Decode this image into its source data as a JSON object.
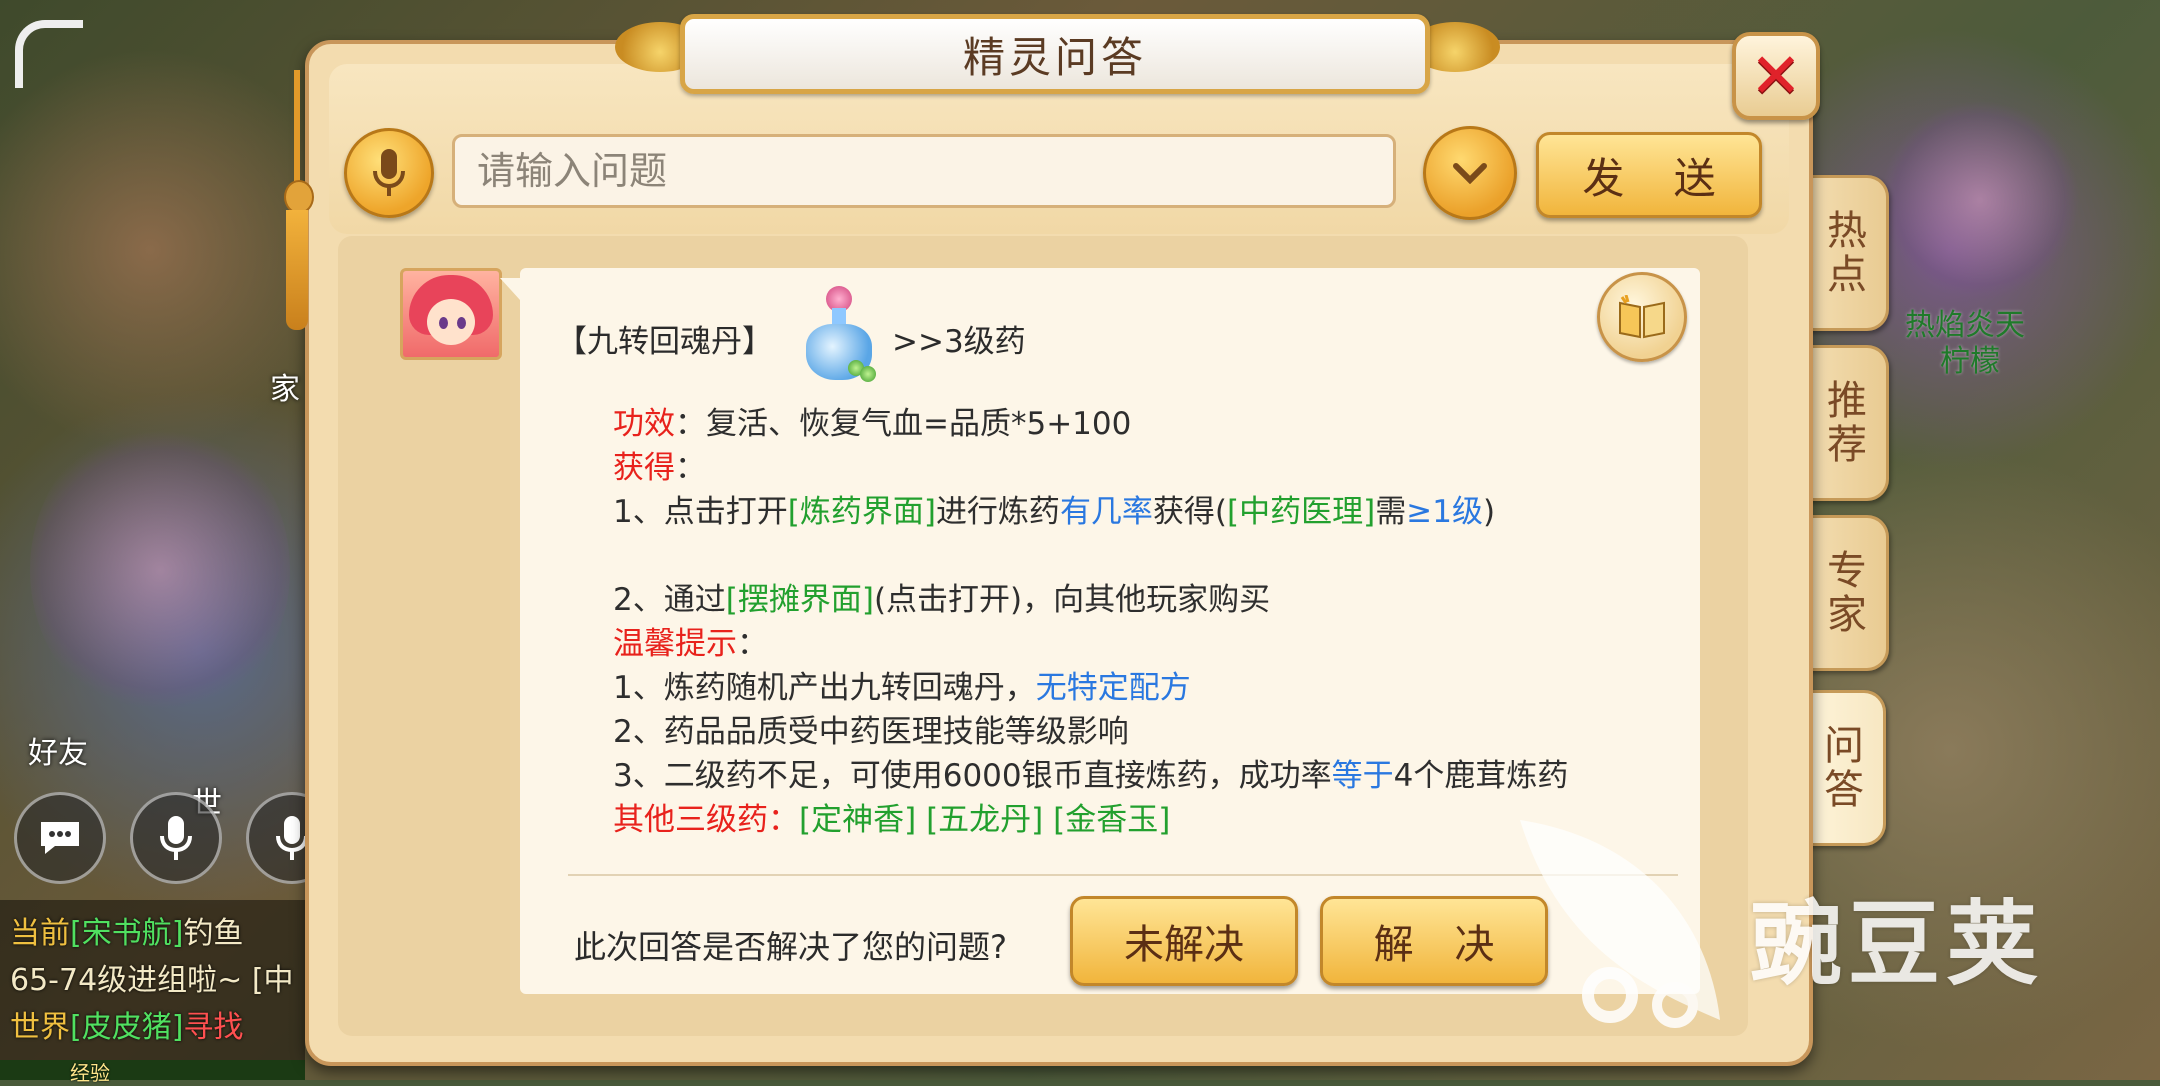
{
  "dialog": {
    "title": "精灵问答",
    "close_symbol": "✕"
  },
  "query": {
    "placeholder": "请输入问题",
    "send_label": "发 送"
  },
  "side_tabs": [
    {
      "label": "热点",
      "active": false
    },
    {
      "label": "推荐",
      "active": false
    },
    {
      "label": "专家",
      "active": false
    },
    {
      "label": "问答",
      "active": true
    }
  ],
  "answer": {
    "item_name": "【九转回魂丹】",
    "item_level": ">>3级药",
    "effect_label": "功效",
    "effect_text": "：复活、恢复气血=品质*5+100",
    "obtain_label": "获得",
    "obtain_colon": "：",
    "obtain_1": {
      "prefix": "1、点击打开",
      "link1": "[炼药界面]",
      "mid": "进行炼药",
      "chance": "有几率",
      "mid2": "获得(",
      "link2": "[中药医理]",
      "need": "需",
      "req": "≥1级",
      "end": ")"
    },
    "obtain_2": {
      "prefix": "2、通过",
      "link": "[摆摊界面]",
      "suffix": "(点击打开)，向其他玩家购买"
    },
    "tips_label": "温馨提示",
    "tips_colon": "：",
    "tip_1": {
      "text": "1、炼药随机产出九转回魂丹，",
      "highlight": "无特定配方"
    },
    "tip_2": {
      "text": "2、药品品质受中药医理技能等级影响"
    },
    "tip_3": {
      "text": "3、二级药不足，可使用6000银币直接炼药，成功率",
      "highlight": "等于",
      "tail": "4个鹿茸炼药"
    },
    "others_label": "其他三级药：",
    "others": [
      "[定神香]",
      "[五龙丹]",
      "[金香玉]"
    ]
  },
  "feedback": {
    "question": "此次回答是否解决了您的问题?",
    "unsolved": "未解决",
    "solved": "解 决"
  },
  "background": {
    "chat_lines": [
      {
        "tag": "当前",
        "channel": "[宋书航]",
        "text": "钓鱼"
      },
      {
        "tag": "",
        "channel": "",
        "text": "65-74级进组啦~ [中"
      },
      {
        "tag": "世界",
        "channel": "[皮皮猪]",
        "text": "寻找"
      }
    ],
    "exp_label": "经验",
    "left_labels": [
      "好友",
      "世",
      "家"
    ],
    "right_labels": [
      "热焰炎天",
      "柠檬"
    ]
  },
  "watermark": {
    "text": "豌豆荚"
  }
}
